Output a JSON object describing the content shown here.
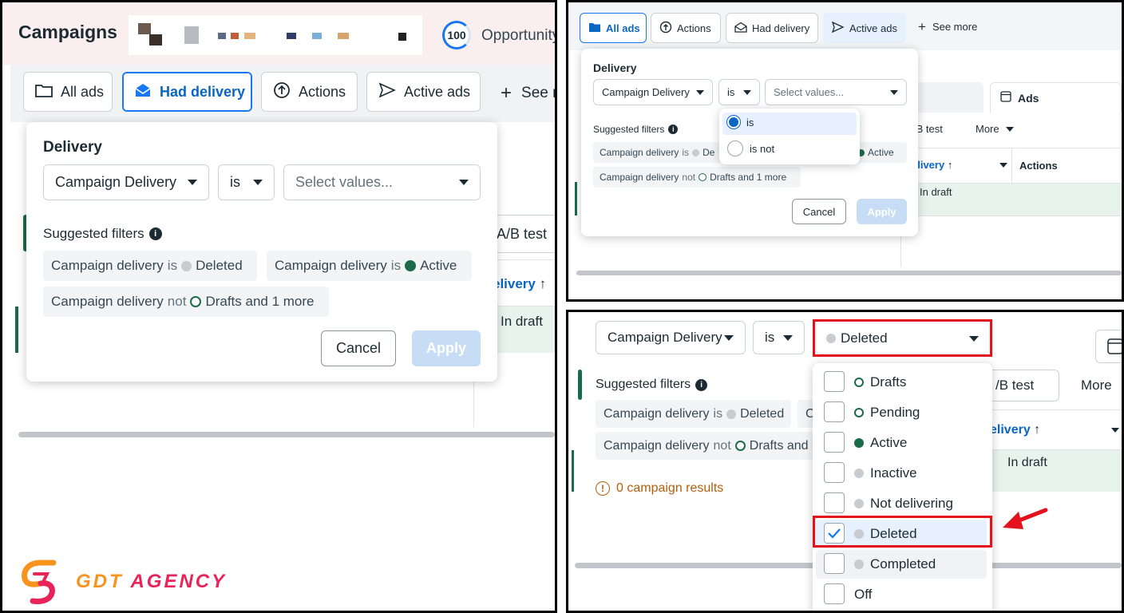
{
  "brand": {
    "text": "GDT AGENCY",
    "colors": {
      "primary": "#f7931e",
      "secondary": "#e8245a"
    }
  },
  "accent": "#1877f2",
  "panel_a": {
    "page_title": "Campaigns",
    "score": "100",
    "opportunity_label": "Opportunity",
    "toolbar": [
      "All ads",
      "Had delivery",
      "Actions",
      "Active ads",
      "See m"
    ],
    "filter": {
      "title": "Delivery",
      "field_value": "Campaign Delivery",
      "operator_value": "is",
      "values_placeholder": "Select values...",
      "suggested_label": "Suggested filters",
      "chips": [
        {
          "prefix": "Campaign delivery",
          "op": "is",
          "value": "Deleted"
        },
        {
          "prefix": "Campaign delivery",
          "op": "is",
          "value": "Active"
        },
        {
          "prefix": "Campaign delivery",
          "op": "not",
          "value": "Drafts and 1 more"
        }
      ],
      "cancel": "Cancel",
      "apply": "Apply"
    },
    "background": {
      "ab_test": "A/B test",
      "delivery_header": "elivery",
      "in_draft": "In draft"
    }
  },
  "panel_b": {
    "toolbar": [
      "All ads",
      "Actions",
      "Had delivery",
      "Active ads",
      "See more"
    ],
    "filter": {
      "title": "Delivery",
      "field_value": "Campaign Delivery",
      "operator_value": "is",
      "values_placeholder": "Select values...",
      "suggested_label": "Suggested filters",
      "chip1_prefix": "Campaign delivery",
      "chip1_op": "is",
      "chip1_value": "De",
      "chip2_value": "Active",
      "chip3_prefix": "Campaign delivery",
      "chip3_op": "not",
      "chip3_value": "Drafts and 1 more",
      "cancel": "Cancel",
      "apply": "Apply"
    },
    "operator_options": [
      "is",
      "is not"
    ],
    "background": {
      "ads_tab": "Ads",
      "ab_test": "/B test",
      "more": "More",
      "delivery_header": "elivery",
      "actions_header": "Actions",
      "in_draft": "In draft"
    }
  },
  "panel_c": {
    "field_value": "Campaign Delivery",
    "operator_value": "is",
    "values_selected": "Deleted",
    "suggested_label": "Suggested filters",
    "chip1": {
      "prefix": "Campaign delivery",
      "op": "is",
      "value": "Deleted"
    },
    "chip1_cut": "C",
    "chip2": {
      "prefix": "Campaign delivery",
      "op": "not",
      "value": "Drafts and"
    },
    "results": "0 campaign results",
    "options": [
      {
        "label": "Drafts",
        "checked": false
      },
      {
        "label": "Pending",
        "checked": false
      },
      {
        "label": "Active",
        "checked": false
      },
      {
        "label": "Inactive",
        "checked": false
      },
      {
        "label": "Not delivering",
        "checked": false
      },
      {
        "label": "Deleted",
        "checked": true
      },
      {
        "label": "Completed",
        "checked": false
      },
      {
        "label": "Off",
        "checked": false
      }
    ],
    "background": {
      "ab_test": "/B test",
      "more": "More",
      "delivery_header": "elivery",
      "in_draft": "In draft"
    }
  }
}
